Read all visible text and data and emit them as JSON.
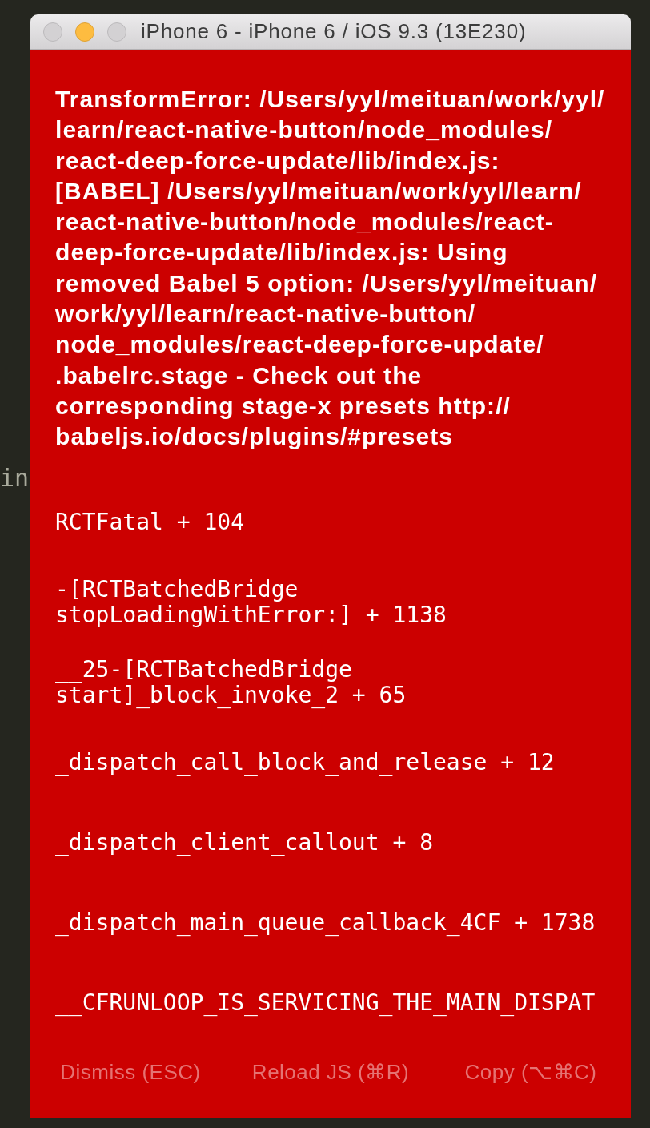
{
  "desktop": {
    "editor_text": "in"
  },
  "window": {
    "title": "iPhone 6 - iPhone 6 / iOS 9.3 (13E230)",
    "controls": [
      {
        "kind": "close",
        "lit": false
      },
      {
        "kind": "minimize",
        "lit": true
      },
      {
        "kind": "zoom",
        "lit": false
      }
    ]
  },
  "red_box": {
    "message": "TransformError: /Users/yyl/meituan/work/yyl/learn/react-native-button/node_modules/react-deep-force-update/lib/index.js: [BABEL] /Users/yyl/meituan/work/yyl/learn/react-native-button/node_modules/react-deep-force-update/lib/index.js: Using removed Babel 5 option: /Users/yyl/meituan/work/yyl/learn/react-native-button/node_modules/react-deep-force-update/.babelrc.stage - Check out the corresponding stage-x presets http://babeljs.io/docs/plugins/#presets",
    "stack": [
      "RCTFatal + 104",
      "-[RCTBatchedBridge stopLoadingWithError:] + 1138",
      "__25-[RCTBatchedBridge start]_block_invoke_2 + 65",
      "_dispatch_call_block_and_release + 12",
      "_dispatch_client_callout + 8",
      "_dispatch_main_queue_callback_4CF + 1738",
      "__CFRUNLOOP_IS_SERVICING_THE_MAIN_DISPAT"
    ],
    "buttons": [
      "Dismiss (ESC)",
      "Reload JS (⌘R)",
      "Copy (⌥⌘C)"
    ]
  }
}
